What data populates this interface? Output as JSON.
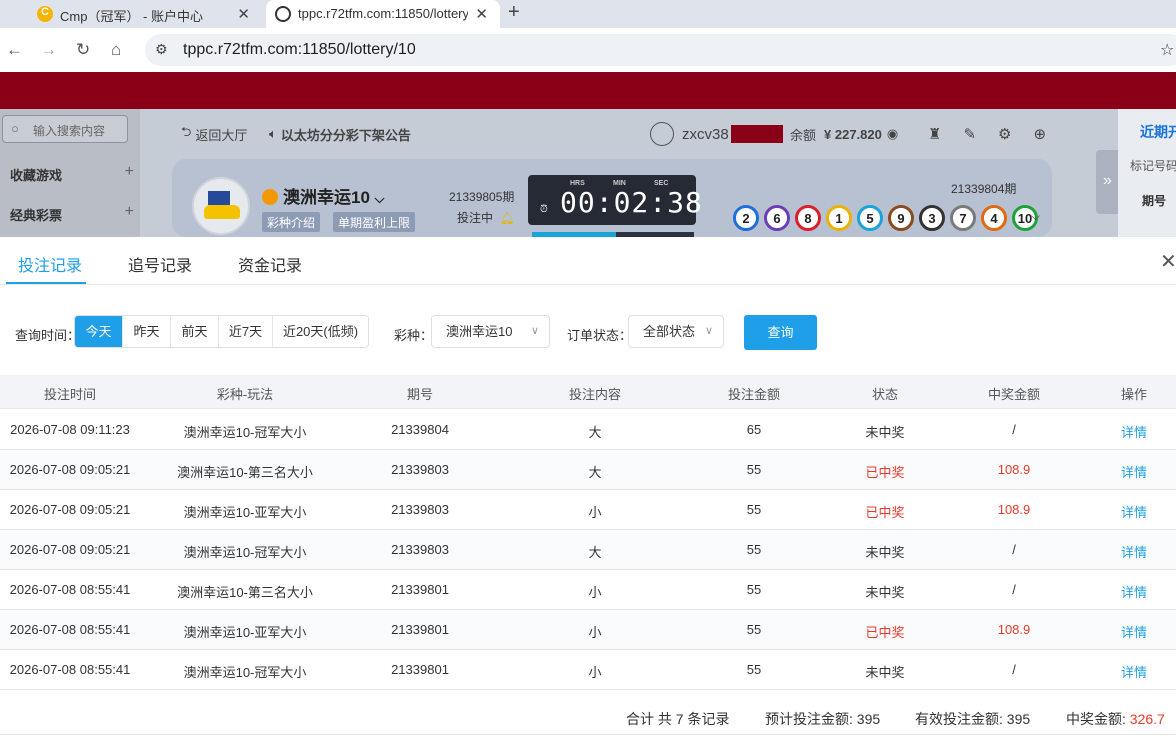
{
  "browser": {
    "tabs": [
      {
        "title": "Cmp（冠军） - 账户中心"
      },
      {
        "title": "tppc.r72tfm.com:11850/lottery/10"
      }
    ],
    "url": "tppc.r72tfm.com:11850/lottery/10"
  },
  "site": {
    "search_placeholder": "输入搜索内容",
    "sidebar": [
      "收藏游戏",
      "经典彩票"
    ],
    "back_lobby": "返回大厅",
    "notice": "以太坊分分彩下架公告",
    "username": "zxcv38",
    "balance_label": "余额",
    "balance_value": "¥ 227.820",
    "game_name": "澳洲幸运10",
    "game_intro": "彩种介绍",
    "single_limit": "单期盈利上限",
    "current_issue": "21339805期",
    "betting_status": "投注中",
    "timer": {
      "hrs_label": "HRS",
      "min_label": "MIN",
      "sec_label": "SEC",
      "value": "00:02:38"
    },
    "timer_progress": 0.52,
    "last_issue": "21339804期",
    "balls": [
      {
        "n": "2",
        "color": "#1e6fd9"
      },
      {
        "n": "6",
        "color": "#6a3fb3"
      },
      {
        "n": "8",
        "color": "#d81e2a"
      },
      {
        "n": "1",
        "color": "#e8b400"
      },
      {
        "n": "5",
        "color": "#1aa3d9"
      },
      {
        "n": "9",
        "color": "#8a4b1f"
      },
      {
        "n": "3",
        "color": "#333333"
      },
      {
        "n": "7",
        "color": "#7a7a7a"
      },
      {
        "n": "4",
        "color": "#e06a12"
      },
      {
        "n": "10",
        "color": "#1aa33a"
      }
    ],
    "right_panel": {
      "title": "近期开",
      "sub": "标记号码",
      "col": "期号"
    }
  },
  "modal": {
    "tabs": [
      "投注记录",
      "追号记录",
      "资金记录"
    ],
    "filters": {
      "time_label": "查询时间：",
      "time_options": [
        "今天",
        "昨天",
        "前天",
        "近7天",
        "近20天(低频)"
      ],
      "game_label": "彩种：",
      "game_value": "澳洲幸运10",
      "status_label": "订单状态：",
      "status_value": "全部状态",
      "query_button": "查询"
    },
    "columns": [
      "投注时间",
      "彩种-玩法",
      "期号",
      "投注内容",
      "投注金额",
      "状态",
      "中奖金额",
      "操作"
    ],
    "rows": [
      {
        "time": "2026-07-08 09:11:23",
        "game": "澳洲幸运10-冠军大小",
        "issue": "21339804",
        "content": "大",
        "amount": "65",
        "status": "未中奖",
        "win": "/",
        "action": "详情",
        "won": false
      },
      {
        "time": "2026-07-08 09:05:21",
        "game": "澳洲幸运10-第三名大小",
        "issue": "21339803",
        "content": "大",
        "amount": "55",
        "status": "已中奖",
        "win": "108.9",
        "action": "详情",
        "won": true
      },
      {
        "time": "2026-07-08 09:05:21",
        "game": "澳洲幸运10-亚军大小",
        "issue": "21339803",
        "content": "小",
        "amount": "55",
        "status": "已中奖",
        "win": "108.9",
        "action": "详情",
        "won": true
      },
      {
        "time": "2026-07-08 09:05:21",
        "game": "澳洲幸运10-冠军大小",
        "issue": "21339803",
        "content": "大",
        "amount": "55",
        "status": "未中奖",
        "win": "/",
        "action": "详情",
        "won": false
      },
      {
        "time": "2026-07-08 08:55:41",
        "game": "澳洲幸运10-第三名大小",
        "issue": "21339801",
        "content": "小",
        "amount": "55",
        "status": "未中奖",
        "win": "/",
        "action": "详情",
        "won": false
      },
      {
        "time": "2026-07-08 08:55:41",
        "game": "澳洲幸运10-亚军大小",
        "issue": "21339801",
        "content": "小",
        "amount": "55",
        "status": "已中奖",
        "win": "108.9",
        "action": "详情",
        "won": true
      },
      {
        "time": "2026-07-08 08:55:41",
        "game": "澳洲幸运10-冠军大小",
        "issue": "21339801",
        "content": "小",
        "amount": "55",
        "status": "未中奖",
        "win": "/",
        "action": "详情",
        "won": false
      }
    ],
    "footer": {
      "total": "合计 共 7 条记录",
      "expected_label": "预计投注金额: ",
      "expected_value": "395",
      "valid_label": "有效投注金额: ",
      "valid_value": "395",
      "win_label": "中奖金额: ",
      "win_value": "326.7"
    }
  }
}
